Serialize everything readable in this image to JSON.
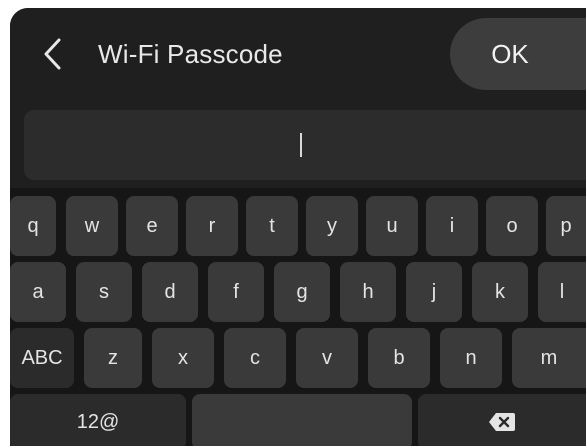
{
  "header": {
    "title": "Wi-Fi Passcode",
    "back_icon": "chevron-left-icon",
    "ok_label": "OK"
  },
  "input": {
    "value": ""
  },
  "keyboard": {
    "row1": [
      "q",
      "w",
      "e",
      "r",
      "t",
      "y",
      "u",
      "i",
      "o",
      "p"
    ],
    "row2": [
      "a",
      "s",
      "d",
      "f",
      "g",
      "h",
      "j",
      "k",
      "l"
    ],
    "row3": {
      "mode_label": "ABC",
      "letters": [
        "z",
        "x",
        "c",
        "v",
        "b",
        "n",
        "m"
      ]
    },
    "row4": {
      "symbols_label": "12@",
      "space_label": "",
      "backspace_icon": "backspace-icon"
    }
  },
  "colors": {
    "background": "#1f1f1f",
    "key": "#3a3a3a",
    "ok_button": "#3d3d3d",
    "text": "#e4e4e4"
  }
}
